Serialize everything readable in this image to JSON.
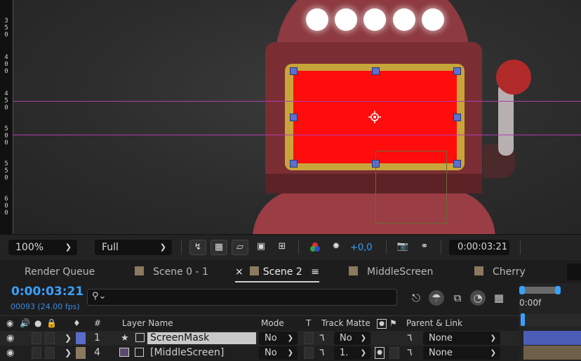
{
  "ruler": {
    "ticks": [
      "3",
      "5",
      "0",
      "4",
      "0",
      "0",
      "4",
      "5",
      "0",
      "5",
      "0",
      "0",
      "5",
      "5",
      "0",
      "6",
      "0",
      "0"
    ]
  },
  "viewer_toolbar": {
    "zoom": "100%",
    "resolution": "Full",
    "exposure": "+0,0",
    "timecode": "0:00:03:21"
  },
  "tabs": [
    {
      "label": "Render Queue",
      "swatch": ""
    },
    {
      "label": "Scene 0 - 1",
      "swatch": "#8b7960"
    },
    {
      "label": "Scene 2",
      "swatch": "#8b7960",
      "active": true,
      "close": "×",
      "menu": "≡"
    },
    {
      "label": "MiddleScreen",
      "swatch": "#8b7960"
    },
    {
      "label": "Cherry",
      "swatch": "#8b7960"
    }
  ],
  "timeline": {
    "timecode": "0:00:03:21",
    "frame_info": "00093 (24.00 fps)",
    "search_icon": "search-icon",
    "time_ruler_label": "0:00f"
  },
  "columns": {
    "layer_name": "Layer Name",
    "number": "#",
    "mode": "Mode",
    "t": "T",
    "track_matte": "Track Matte",
    "parent_link": "Parent & Link"
  },
  "layers": [
    {
      "number": "1",
      "name": "ScreenMask",
      "label_color": "#5a6bc8",
      "mode": "No",
      "matte": "No",
      "parent": "None",
      "selected": true
    },
    {
      "number": "4",
      "name": "[MiddleScreen]",
      "label_color": "#8b7960",
      "mode": "No",
      "matte": "1. ",
      "parent": "None",
      "selected": false
    }
  ],
  "colors": {
    "accent": "#3aa0ff",
    "mask_fill": "#ff0d0d",
    "guide": "#b03cb0",
    "vertex": "#5d6fd0"
  }
}
